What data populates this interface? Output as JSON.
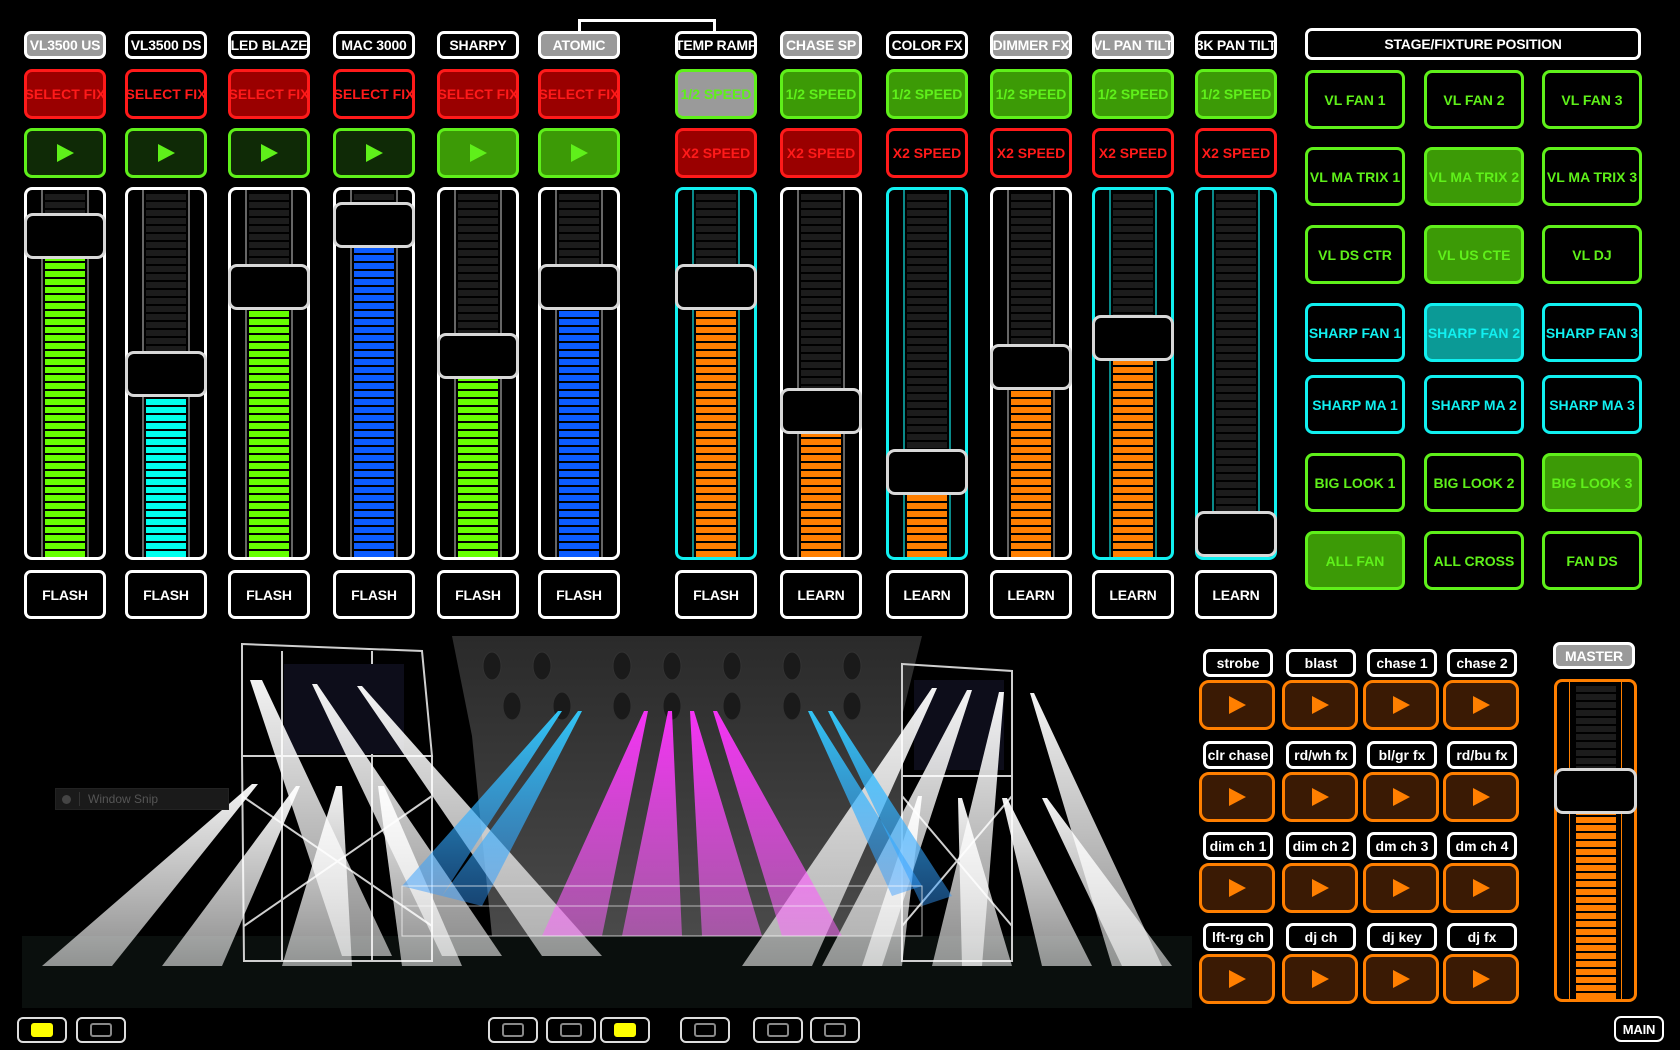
{
  "colors": {
    "background": "#000000",
    "green": "#5ff01a",
    "red": "#ff1a1a",
    "cyan": "#11f0f0",
    "orange": "#ff7f00",
    "blue": "#0b5cff",
    "meter_green": "#66ff00",
    "meter_cyan": "#00ffee"
  },
  "link_group": {
    "from": "ATOMIC",
    "to": "TEMP RAMP"
  },
  "fixture_channels": [
    {
      "label": "VL3500 US",
      "label_active": true,
      "select_label": "SELECT FIX",
      "select_active": true,
      "play_icon": "play-icon",
      "play_active": false,
      "level": 0.82,
      "meter_color": "#66ff00",
      "flash_label": "FLASH"
    },
    {
      "label": "VL3500 DS",
      "label_active": false,
      "select_label": "SELECT FIX",
      "select_active": false,
      "play_icon": "play-icon",
      "play_active": false,
      "level": 0.44,
      "meter_color": "#00ffee",
      "flash_label": "FLASH"
    },
    {
      "label": "LED BLAZE",
      "label_active": false,
      "select_label": "SELECT FIX",
      "select_active": true,
      "play_icon": "play-icon",
      "play_active": false,
      "level": 0.68,
      "meter_color": "#66ff00",
      "flash_label": "FLASH"
    },
    {
      "label": "MAC 3000",
      "label_active": false,
      "select_label": "SELECT FIX",
      "select_active": false,
      "play_icon": "play-icon",
      "play_active": false,
      "level": 0.85,
      "meter_color": "#0b5cff",
      "flash_label": "FLASH"
    },
    {
      "label": "SHARPY",
      "label_active": false,
      "select_label": "SELECT FIX",
      "select_active": true,
      "play_icon": "play-icon",
      "play_active": true,
      "level": 0.49,
      "meter_color": "#66ff00",
      "flash_label": "FLASH"
    },
    {
      "label": "ATOMIC",
      "label_active": true,
      "select_label": "SELECT FIX",
      "select_active": true,
      "play_icon": "play-icon",
      "play_active": true,
      "level": 0.68,
      "meter_color": "#0b5cff",
      "flash_label": "FLASH"
    }
  ],
  "effect_channels": [
    {
      "label": "TEMP RAMP",
      "label_active": false,
      "half_label": "1/2 SPEED",
      "half_state": "grey",
      "x2_label": "X2 SPEED",
      "x2_active": true,
      "level": 0.68,
      "frame": "cyan",
      "bottom_label": "FLASH"
    },
    {
      "label": "CHASE SP",
      "label_active": true,
      "half_label": "1/2 SPEED",
      "half_state": "on",
      "x2_label": "X2 SPEED",
      "x2_active": true,
      "level": 0.34,
      "frame": "white",
      "bottom_label": "LEARN"
    },
    {
      "label": "COLOR FX",
      "label_active": false,
      "half_label": "1/2 SPEED",
      "half_state": "on",
      "x2_label": "X2 SPEED",
      "x2_active": false,
      "level": 0.17,
      "frame": "cyan",
      "bottom_label": "LEARN"
    },
    {
      "label": "DIMMER FX",
      "label_active": true,
      "half_label": "1/2 SPEED",
      "half_state": "on",
      "x2_label": "X2 SPEED",
      "x2_active": false,
      "level": 0.46,
      "frame": "white",
      "bottom_label": "LEARN"
    },
    {
      "label": "VL PAN TILT",
      "label_active": true,
      "half_label": "1/2 SPEED",
      "half_state": "on",
      "x2_label": "X2 SPEED",
      "x2_active": false,
      "level": 0.54,
      "frame": "cyan",
      "bottom_label": "LEARN"
    },
    {
      "label": "3K PAN TILT",
      "label_active": false,
      "half_label": "1/2 SPEED",
      "half_state": "on",
      "x2_label": "X2 SPEED",
      "x2_active": false,
      "level": 0.0,
      "frame": "cyan",
      "bottom_label": "LEARN"
    }
  ],
  "position_panel": {
    "title": "STAGE/FIXTURE POSITION",
    "buttons": [
      {
        "label": "VL FAN 1",
        "color": "green",
        "active": false
      },
      {
        "label": "VL FAN 2",
        "color": "green",
        "active": false
      },
      {
        "label": "VL FAN 3",
        "color": "green",
        "active": false
      },
      {
        "label": "VL MA TRIX 1",
        "color": "green",
        "active": false
      },
      {
        "label": "VL MA TRIX 2",
        "color": "green",
        "active": true
      },
      {
        "label": "VL MA TRIX 3",
        "color": "green",
        "active": false
      },
      {
        "label": "VL DS CTR",
        "color": "green",
        "active": false
      },
      {
        "label": "VL US CTE",
        "color": "green",
        "active": true
      },
      {
        "label": "VL DJ",
        "color": "green",
        "active": false
      },
      {
        "label": "SHARP FAN 1",
        "color": "cyan",
        "active": false
      },
      {
        "label": "SHARP FAN 2",
        "color": "cyan",
        "active": true
      },
      {
        "label": "SHARP FAN 3",
        "color": "cyan",
        "active": false
      },
      {
        "label": "SHARP MA 1",
        "color": "cyan",
        "active": false
      },
      {
        "label": "SHARP MA 2",
        "color": "cyan",
        "active": false
      },
      {
        "label": "SHARP MA 3",
        "color": "cyan",
        "active": false
      },
      {
        "label": "BIG LOOK 1",
        "color": "green",
        "active": false
      },
      {
        "label": "BIG LOOK 2",
        "color": "green",
        "active": false
      },
      {
        "label": "BIG LOOK 3",
        "color": "green",
        "active": true
      },
      {
        "label": "ALL FAN",
        "color": "green",
        "active": true
      },
      {
        "label": "ALL CROSS",
        "color": "green",
        "active": false
      },
      {
        "label": "FAN DS",
        "color": "green",
        "active": false
      }
    ]
  },
  "cue_pads": [
    {
      "label": "strobe"
    },
    {
      "label": "blast"
    },
    {
      "label": "chase 1"
    },
    {
      "label": "chase 2"
    },
    {
      "label": "clr chase"
    },
    {
      "label": "rd/wh fx"
    },
    {
      "label": "bl/gr fx"
    },
    {
      "label": "rd/bu fx"
    },
    {
      "label": "dim ch 1"
    },
    {
      "label": "dim ch 2"
    },
    {
      "label": "dm ch 3"
    },
    {
      "label": "dm ch 4"
    },
    {
      "label": "lft-rg ch"
    },
    {
      "label": "dj ch"
    },
    {
      "label": "dj key"
    },
    {
      "label": "dj fx"
    }
  ],
  "master": {
    "label": "MASTER",
    "level": 0.59
  },
  "stage_view": {
    "description": "3D stage visualizer with truss towers, moving head beams (white, cyan, magenta)",
    "overlay_label": "Window Snip"
  },
  "bottom_bar": {
    "page_buttons": [
      {
        "active": true
      },
      {
        "active": false
      },
      {
        "active": false
      },
      {
        "active": false
      },
      {
        "active": true
      },
      {
        "active": false
      },
      {
        "active": false
      },
      {
        "active": false
      }
    ],
    "main_label": "MAIN"
  }
}
